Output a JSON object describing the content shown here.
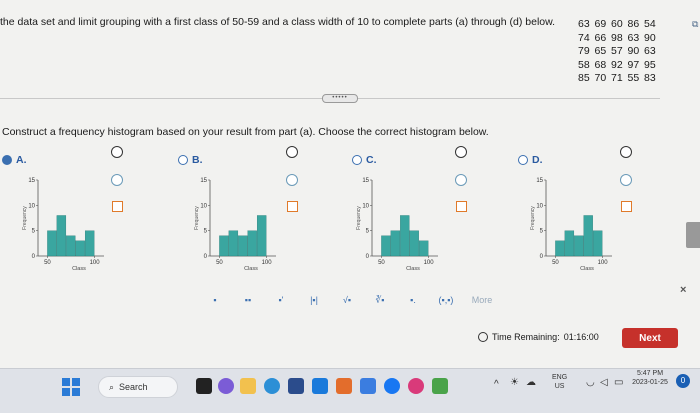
{
  "question": {
    "prompt": "the data set and limit grouping with a first class of 50-59 and a class width of 10 to complete parts (a) through (d) below.",
    "data_rows": [
      [
        "63",
        "69",
        "60",
        "86",
        "54"
      ],
      [
        "74",
        "66",
        "98",
        "63",
        "90"
      ],
      [
        "79",
        "65",
        "57",
        "90",
        "63"
      ],
      [
        "58",
        "68",
        "92",
        "97",
        "95"
      ],
      [
        "85",
        "70",
        "71",
        "55",
        "83"
      ]
    ],
    "more_pill": "•••••",
    "instruction": "Construct a frequency histogram based on your result from part (a). Choose the correct histogram below."
  },
  "options": [
    {
      "letter": "A.",
      "selected": true
    },
    {
      "letter": "B.",
      "selected": false
    },
    {
      "letter": "C.",
      "selected": false
    },
    {
      "letter": "D.",
      "selected": false
    }
  ],
  "chart_data": [
    {
      "type": "bar",
      "option": "A",
      "categories": [
        "50-59",
        "60-69",
        "70-79",
        "80-89",
        "90-99"
      ],
      "values": [
        5,
        8,
        4,
        3,
        5
      ],
      "xlabel": "Class",
      "ylabel": "Frequency",
      "yticks": [
        "0",
        "5",
        "10",
        "15"
      ],
      "xticks": [
        "50",
        "100"
      ],
      "ylim": [
        0,
        15
      ],
      "color": "#3aa6a0"
    },
    {
      "type": "bar",
      "option": "B",
      "categories": [
        "50-59",
        "60-69",
        "70-79",
        "80-89",
        "90-99"
      ],
      "values": [
        4,
        5,
        4,
        5,
        8
      ],
      "xlabel": "Class",
      "ylabel": "Frequency",
      "yticks": [
        "0",
        "5",
        "10",
        "15"
      ],
      "xticks": [
        "50",
        "100"
      ],
      "ylim": [
        0,
        15
      ],
      "color": "#3aa6a0"
    },
    {
      "type": "bar",
      "option": "C",
      "categories": [
        "50-59",
        "60-69",
        "70-79",
        "80-89",
        "90-99"
      ],
      "values": [
        4,
        5,
        8,
        5,
        3
      ],
      "xlabel": "Class",
      "ylabel": "Frequency",
      "yticks": [
        "0",
        "5",
        "10",
        "15"
      ],
      "xticks": [
        "50",
        "100"
      ],
      "ylim": [
        0,
        15
      ],
      "color": "#3aa6a0"
    },
    {
      "type": "bar",
      "option": "D",
      "categories": [
        "50-59",
        "60-69",
        "70-79",
        "80-89",
        "90-99"
      ],
      "values": [
        3,
        5,
        4,
        8,
        5
      ],
      "xlabel": "Class",
      "ylabel": "Frequency",
      "yticks": [
        "0",
        "5",
        "10",
        "15"
      ],
      "xticks": [
        "50",
        "100"
      ],
      "ylim": [
        0,
        15
      ],
      "color": "#3aa6a0"
    }
  ],
  "toolbar": {
    "tools": [
      "▪",
      "▪▪",
      "▪'",
      "|▪|",
      "√▪",
      "∛▪",
      "▪.",
      "(▪,▪)"
    ],
    "more": "More"
  },
  "footer": {
    "timer_label": "Time Remaining:",
    "timer_value": "01:16:00",
    "next": "Next",
    "close": "×"
  },
  "taskbar": {
    "search": "Search",
    "lang_top": "ENG",
    "lang_bottom": "US",
    "time": "5:47 PM",
    "date": "2023-01-25",
    "notification_count": "0"
  },
  "colors": {
    "bar": "#3aa6a0",
    "next_button": "#c6312b",
    "option_letter": "#2a5aa0"
  }
}
